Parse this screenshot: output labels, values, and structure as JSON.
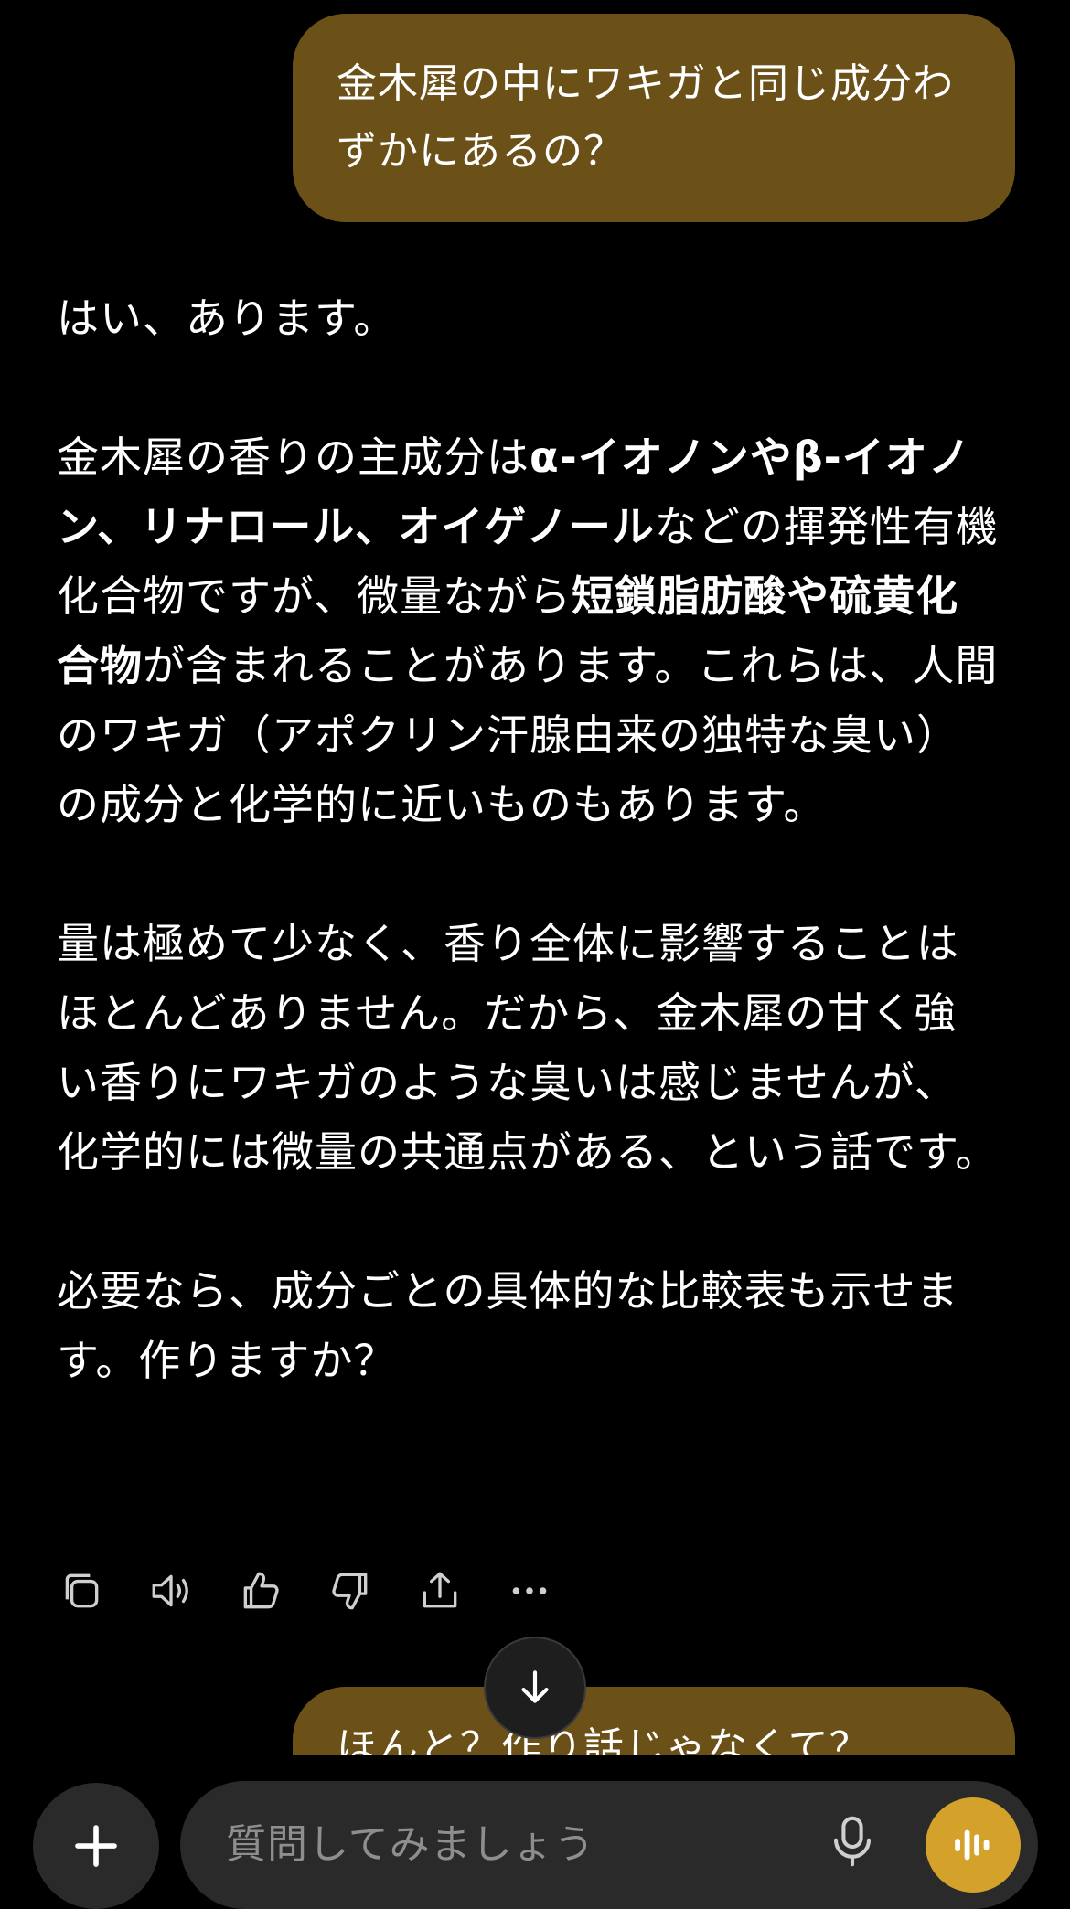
{
  "conversation": {
    "user_message_1": "金木犀の中にワキガと同じ成分わずかにあるの？",
    "assistant_reply": {
      "p1": "はい、あります。",
      "p2": {
        "t1": "金木犀の香りの主成分は",
        "b1": "α-イオノンやβ-イオノン、リナロール、オイゲノール",
        "t2": "などの揮発性有機化合物ですが、微量ながら",
        "b2": "短鎖脂肪酸や硫黄化合物",
        "t3": "が含まれることがあります。これらは、人間のワキガ（アポクリン汗腺由来の独特な臭い）の成分と化学的に近いものもあります。"
      },
      "p3": "量は極めて少なく、香り全体に影響することはほとんどありません。だから、金木犀の甘く強い香りにワキガのような臭いは感じませんが、化学的には微量の共通点がある、という話です。",
      "p4": "必要なら、成分ごとの具体的な比較表も示せます。作りますか？"
    },
    "user_message_2": "ほんと？作り話じゃなくて？"
  },
  "actions": [
    "copy-icon",
    "read-aloud-icon",
    "thumbs-up-icon",
    "thumbs-down-icon",
    "share-icon",
    "more-icon"
  ],
  "composer": {
    "placeholder": "質問してみましょう"
  },
  "colors": {
    "background": "#000000",
    "user_bubble": "#6b5118",
    "composer_bg": "#2a2a2a",
    "voice_button": "#d4a22a",
    "placeholder": "#8e8e8e"
  }
}
